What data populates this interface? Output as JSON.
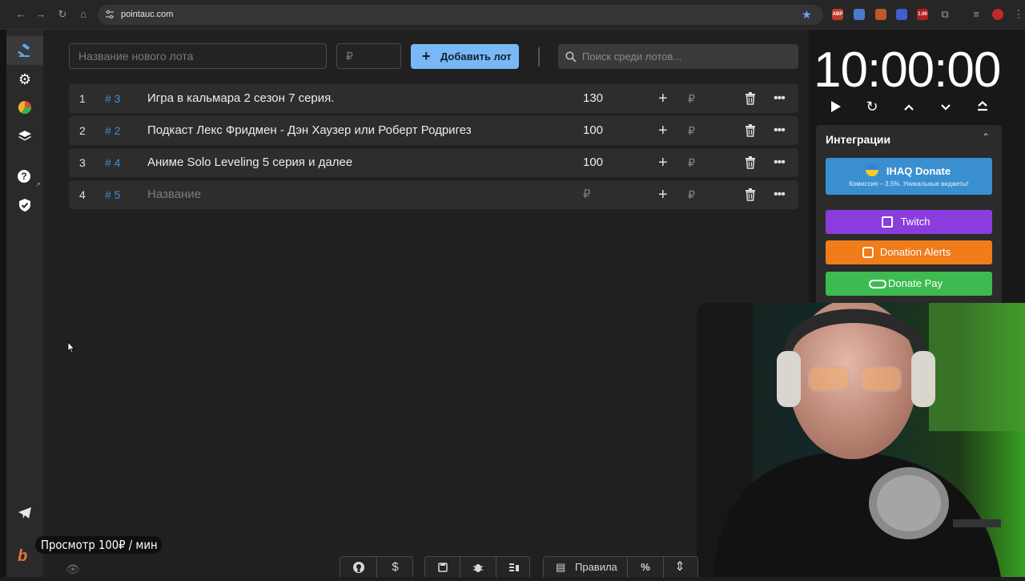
{
  "browser": {
    "url": "pointauc.com",
    "extensions": [
      {
        "name": "abp-extension-icon",
        "label": "ABP",
        "color": "#c0392b"
      },
      {
        "name": "shield-extension-icon",
        "label": "",
        "color": "#4a7bd0"
      },
      {
        "name": "puzzle-red-extension-icon",
        "label": "",
        "color": "#c0572b"
      },
      {
        "name": "blue-circle-extension-icon",
        "label": "",
        "color": "#3f5fd0"
      },
      {
        "name": "speed-extension-icon",
        "label": "1.00",
        "color": "#b02020"
      }
    ]
  },
  "toolbar": {
    "lot_name_placeholder": "Название нового лота",
    "amount_placeholder": "₽",
    "add_button_label": "Добавить лот",
    "search_placeholder": "Поиск среди лотов..."
  },
  "lots": [
    {
      "num": "1",
      "id": "# 3",
      "name": "Игра в кальмара 2 сезон 7 серия.",
      "amount": "130",
      "rub": "₽",
      "placeholder": false
    },
    {
      "num": "2",
      "id": "# 2",
      "name": " Подкаст Лекс Фридмен - Дэн Хаузер или Роберт Родригез",
      "amount": "100",
      "rub": "₽",
      "placeholder": false
    },
    {
      "num": "3",
      "id": "# 4",
      "name": "Аниме Solo Leveling 5 серия и далее",
      "amount": "100",
      "rub": "₽",
      "placeholder": false
    },
    {
      "num": "4",
      "id": "# 5",
      "name": "Название",
      "amount": "₽",
      "rub": "₽",
      "placeholder": true
    }
  ],
  "timer": {
    "value": "10:00:00"
  },
  "integrations": {
    "title": "Интеграции",
    "buttons": [
      {
        "label": "IHAQ Donate",
        "sub": "Комиссия – 3,5%. Уникальные виджеты!",
        "color": "#3a8fd0"
      },
      {
        "label": "Twitch",
        "sub": "",
        "color": "#8a3ddc"
      },
      {
        "label": "Donation Alerts",
        "sub": "",
        "color": "#f07c1a"
      },
      {
        "label": "Donate Pay",
        "sub": "",
        "color": "#3dbb50"
      }
    ]
  },
  "overlay": {
    "badge": "Просмотр 100₽ / мин"
  },
  "bottom": {
    "rules_label": "Правила",
    "dollar": "$",
    "percent": "%"
  }
}
